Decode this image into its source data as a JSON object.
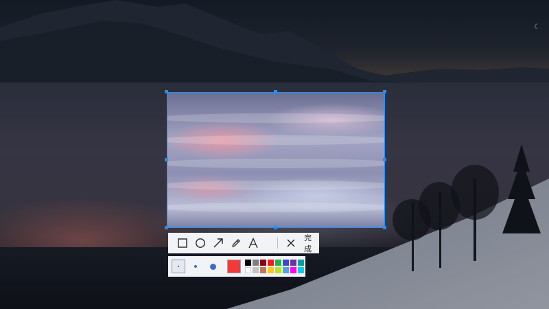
{
  "toolbar": {
    "tools": [
      {
        "name": "rectangle-icon"
      },
      {
        "name": "ellipse-icon"
      },
      {
        "name": "arrow-icon"
      },
      {
        "name": "pencil-icon"
      },
      {
        "name": "text-icon",
        "glyph": "A"
      },
      {
        "name": "close-icon"
      }
    ],
    "done_label": "完成"
  },
  "palette": {
    "brush_sizes": [
      "small",
      "medium",
      "large"
    ],
    "selected_size": "small",
    "current_color": "#f23a3a",
    "swatches": [
      "#000000",
      "#7f7f7f",
      "#880015",
      "#ed1c24",
      "#22b14c",
      "#3f48cc",
      "#7030a0",
      "#00a2a0",
      "#ffffff",
      "#c3c3c3",
      "#b97a57",
      "#ffc90e",
      "#b5e61d",
      "#4fa3e8",
      "#ff00ff",
      "#00d0e0"
    ]
  },
  "colors": {
    "selection_border": "#1e90ff",
    "toolbar_bg": "#f1f3f6"
  }
}
